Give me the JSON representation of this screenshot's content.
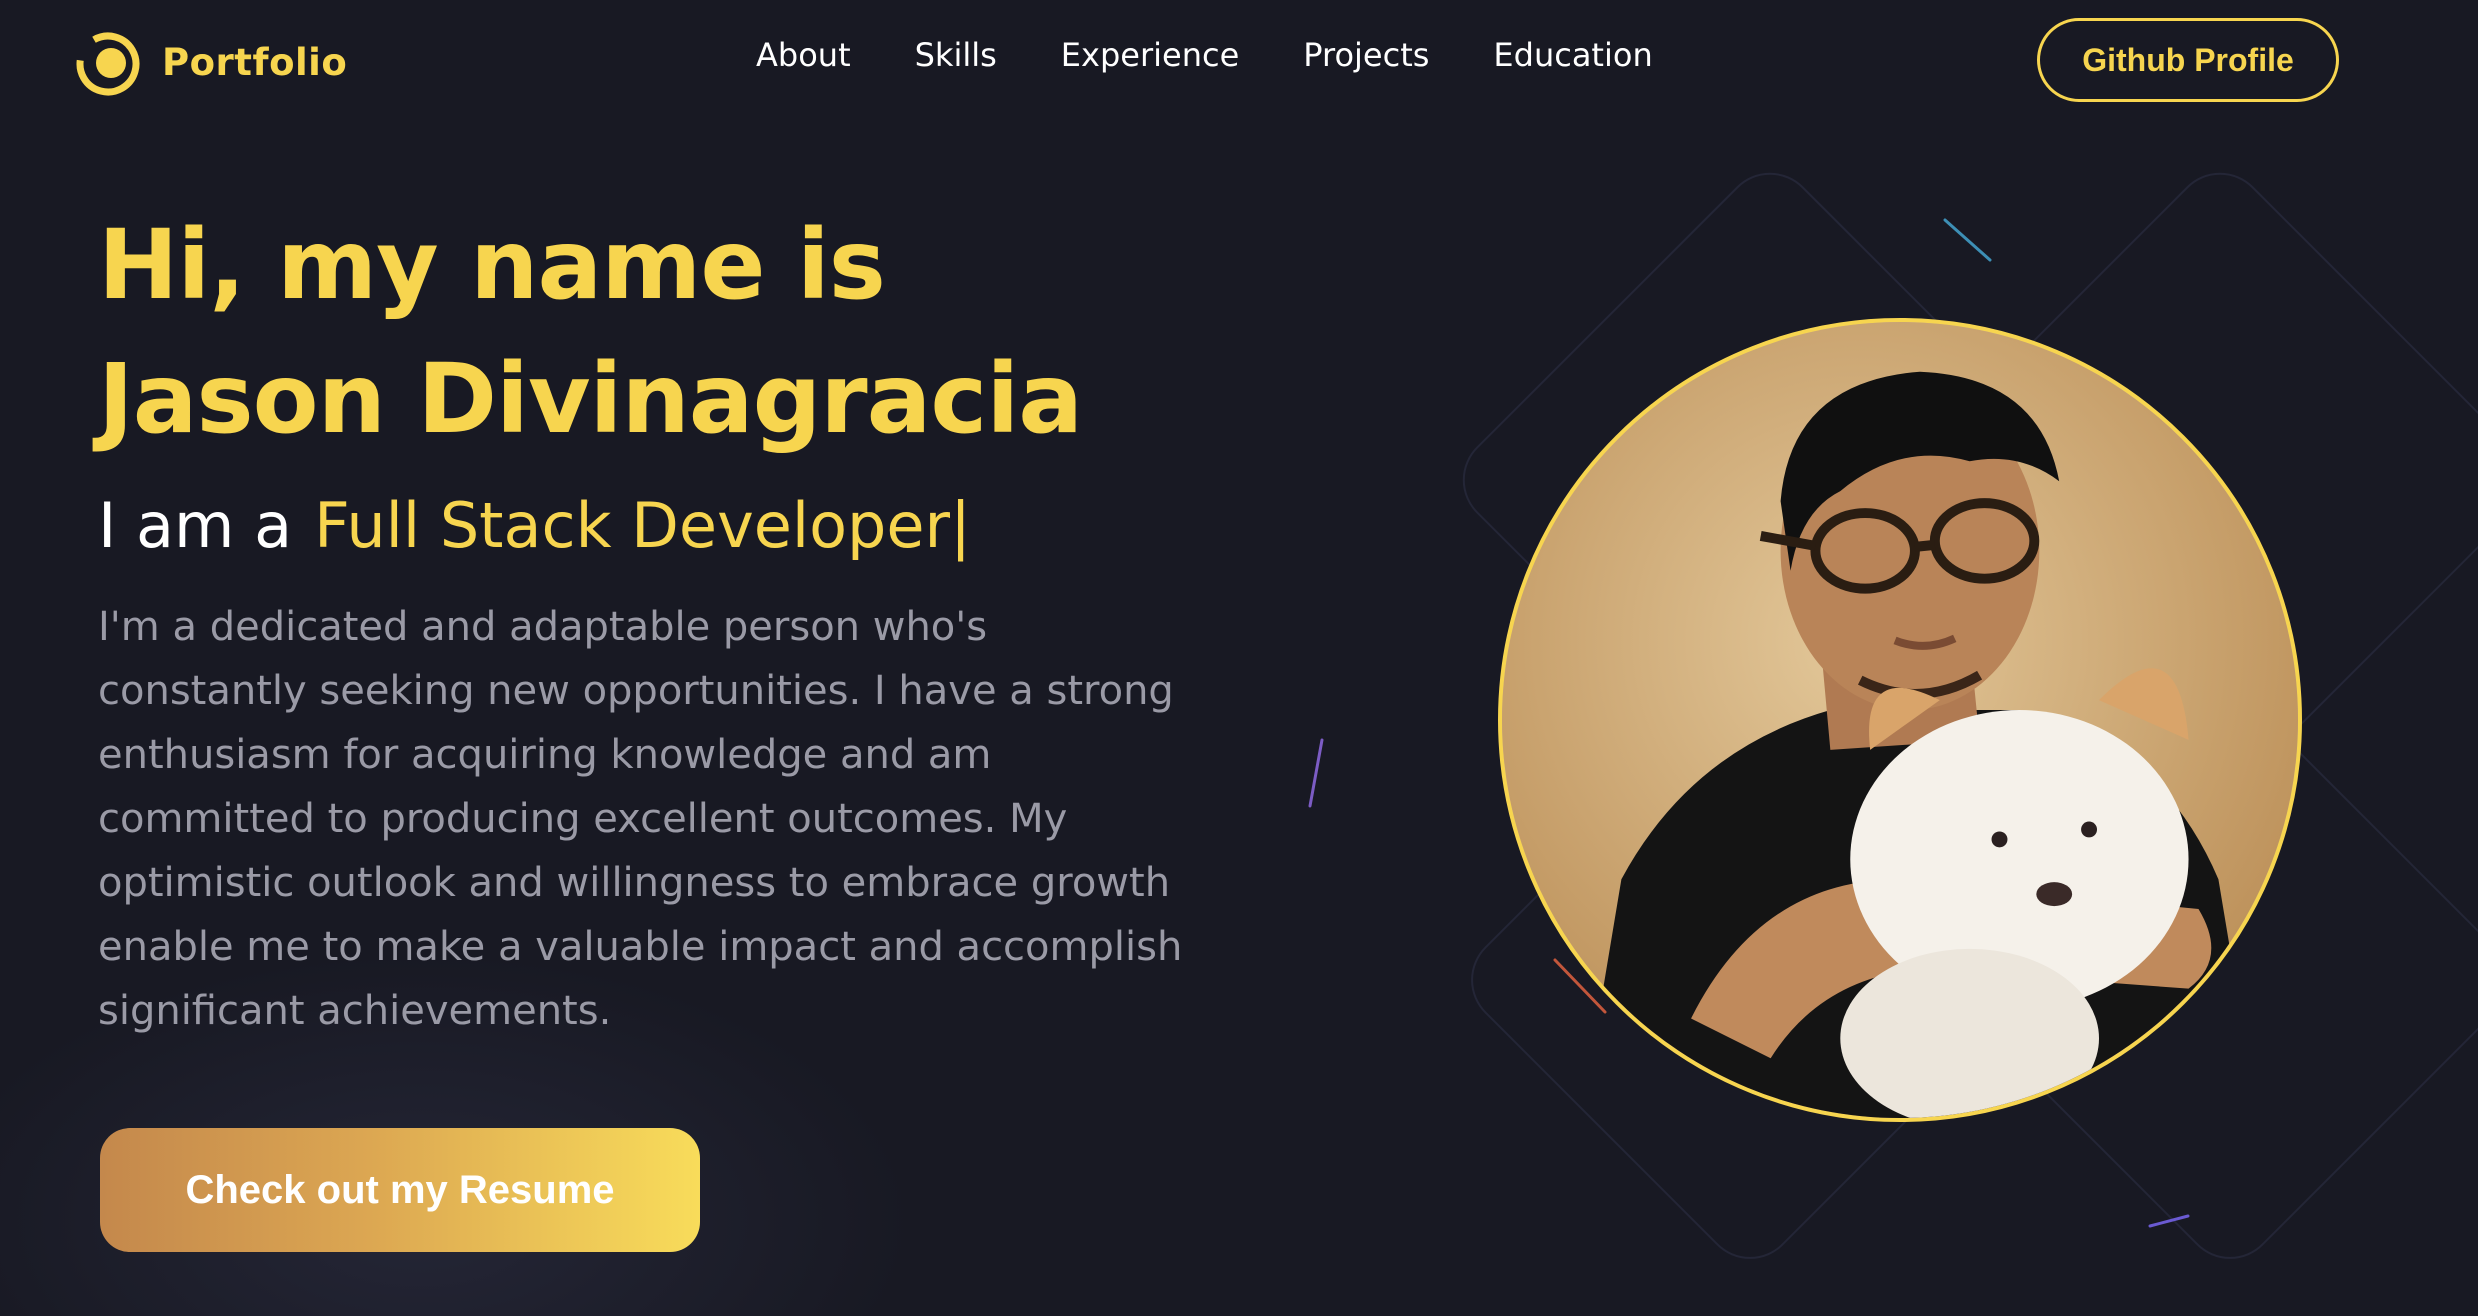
{
  "brand": {
    "logo_text": "Portfolio",
    "logo_icon": "portfolio-logo-icon",
    "accent_color": "#f7d54f",
    "background_color": "#181923"
  },
  "nav": {
    "links": [
      {
        "label": "About"
      },
      {
        "label": "Skills"
      },
      {
        "label": "Experience"
      },
      {
        "label": "Projects"
      },
      {
        "label": "Education"
      }
    ],
    "github_label": "Github Profile"
  },
  "hero": {
    "title_line1": "Hi, my name is",
    "title_line2": "Jason Divinagracia",
    "role_prefix": "I am a",
    "role_text": "Full Stack Developer",
    "caret": "|",
    "bio": "I'm a dedicated and adaptable person who's constantly seeking new opportunities. I have a strong enthusiasm for acquiring knowledge and am committed to producing excellent outcomes. My optimistic outlook and willingness to embrace growth enable me to make a valuable impact and accomplish significant achievements.",
    "resume_button": "Check out my Resume"
  }
}
